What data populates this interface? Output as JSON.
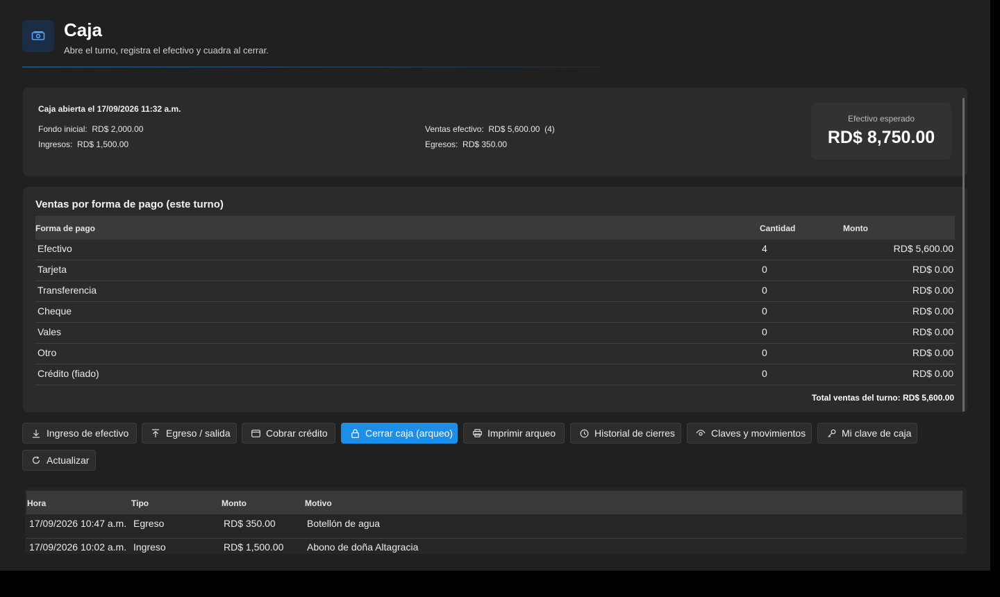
{
  "header": {
    "icon": "cash-register-icon",
    "title": "Caja",
    "subtitle": "Abre el turno, registra el efectivo y cuadra al cerrar."
  },
  "summary": {
    "opened_label": "Caja abierta el 17/09/2026 11:32 a.m.",
    "fondo_inicial": "Fondo inicial:  RD$ 2,000.00",
    "ingresos": "Ingresos:  RD$ 1,500.00",
    "ventas_efectivo": "Ventas efectivo:  RD$ 5,600.00  (4)",
    "egresos": "Egresos:  RD$ 350.00",
    "expected_label": "Efectivo esperado",
    "expected_value": "RD$ 8,750.00"
  },
  "sales": {
    "title": "Ventas por forma de pago (este turno)",
    "columns": {
      "method": "Forma de pago",
      "qty": "Cantidad",
      "amount": "Monto"
    },
    "rows": [
      {
        "method": "Efectivo",
        "qty": "4",
        "amount": "RD$ 5,600.00"
      },
      {
        "method": "Tarjeta",
        "qty": "0",
        "amount": "RD$ 0.00"
      },
      {
        "method": "Transferencia",
        "qty": "0",
        "amount": "RD$ 0.00"
      },
      {
        "method": "Cheque",
        "qty": "0",
        "amount": "RD$ 0.00"
      },
      {
        "method": "Vales",
        "qty": "0",
        "amount": "RD$ 0.00"
      },
      {
        "method": "Otro",
        "qty": "0",
        "amount": "RD$ 0.00"
      },
      {
        "method": "Crédito (fiado)",
        "qty": "0",
        "amount": "RD$ 0.00"
      }
    ],
    "total": "Total ventas del turno:  RD$ 5,600.00"
  },
  "actions": {
    "ingreso": "Ingreso de efectivo",
    "egreso": "Egreso / salida",
    "cobrar": "Cobrar crédito",
    "cerrar": "Cerrar caja (arqueo)",
    "imprimir": "Imprimir arqueo",
    "historial": "Historial de cierres",
    "claves": "Claves y movimientos",
    "mi_clave": "Mi clave de caja",
    "actualizar": "Actualizar"
  },
  "movements": {
    "columns": {
      "time": "Hora",
      "type": "Tipo",
      "amount": "Monto",
      "reason": "Motivo"
    },
    "rows": [
      {
        "time": "17/09/2026 10:47 a.m.",
        "type": "Egreso",
        "amount": "RD$ 350.00",
        "reason": "Botellón de agua"
      },
      {
        "time": "17/09/2026 10:02 a.m.",
        "type": "Ingreso",
        "amount": "RD$ 1,500.00",
        "reason": "Abono de doña Altagracia"
      }
    ]
  },
  "colors": {
    "accent": "#1e8fe8",
    "background": "#202020",
    "card": "#2b2b2b"
  }
}
